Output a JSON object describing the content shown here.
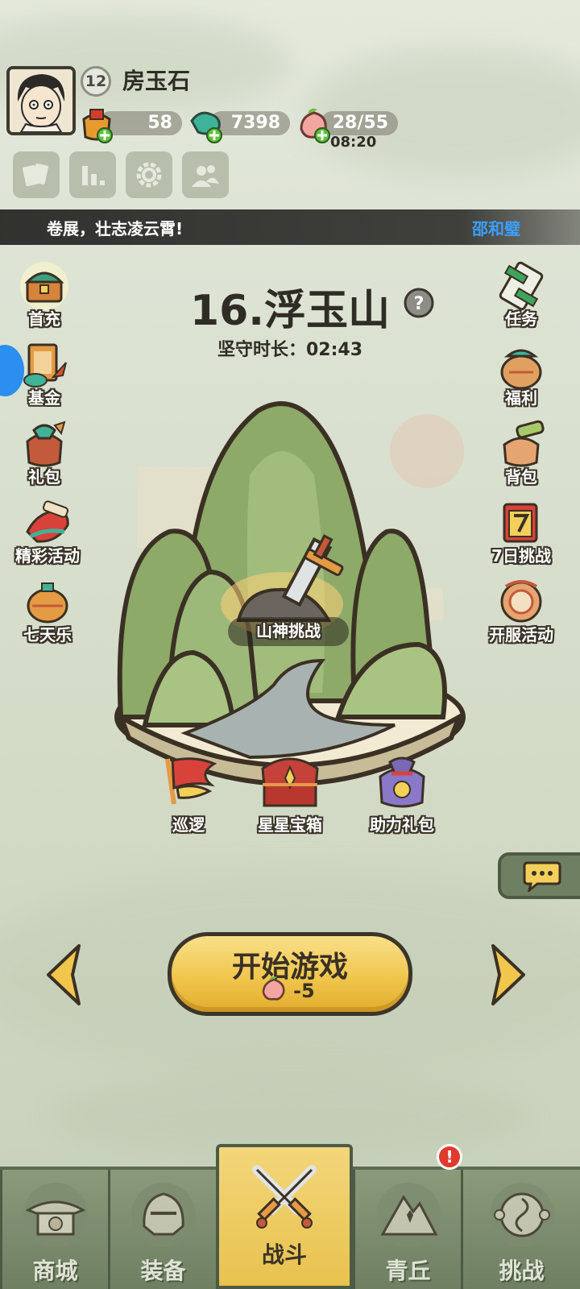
{
  "player": {
    "level": "12",
    "name": "房玉石",
    "gold": "58",
    "jade": "7398",
    "stamina": "28/55",
    "stamina_timer": "08:20"
  },
  "marquee": {
    "message": "卷展，壮志凌云霄!",
    "user": "邵和璧"
  },
  "left_menu": [
    "首充",
    "基金",
    "礼包",
    "精彩活动",
    "七天乐"
  ],
  "right_menu": [
    "任务",
    "福利",
    "背包",
    "7日挑战",
    "开服活动"
  ],
  "stage": {
    "title": "16.浮玉山",
    "hold_time": "坚守时长：02:43",
    "challenge_label": "山神挑战",
    "patrol_label": "巡逻",
    "star_chest_label": "星星宝箱",
    "assist_pack_label": "助力礼包"
  },
  "start": {
    "label": "开始游戏",
    "cost": "-5"
  },
  "nav": {
    "tabs": [
      "商城",
      "装备",
      "战斗",
      "青丘",
      "挑战"
    ],
    "active": "战斗",
    "badge": "!"
  },
  "colors": {
    "accent_yellow": "#f0c64d",
    "nav_green": "#6f7f62",
    "marquee_user": "#3aa0ff",
    "badge_red": "#e0392e"
  }
}
